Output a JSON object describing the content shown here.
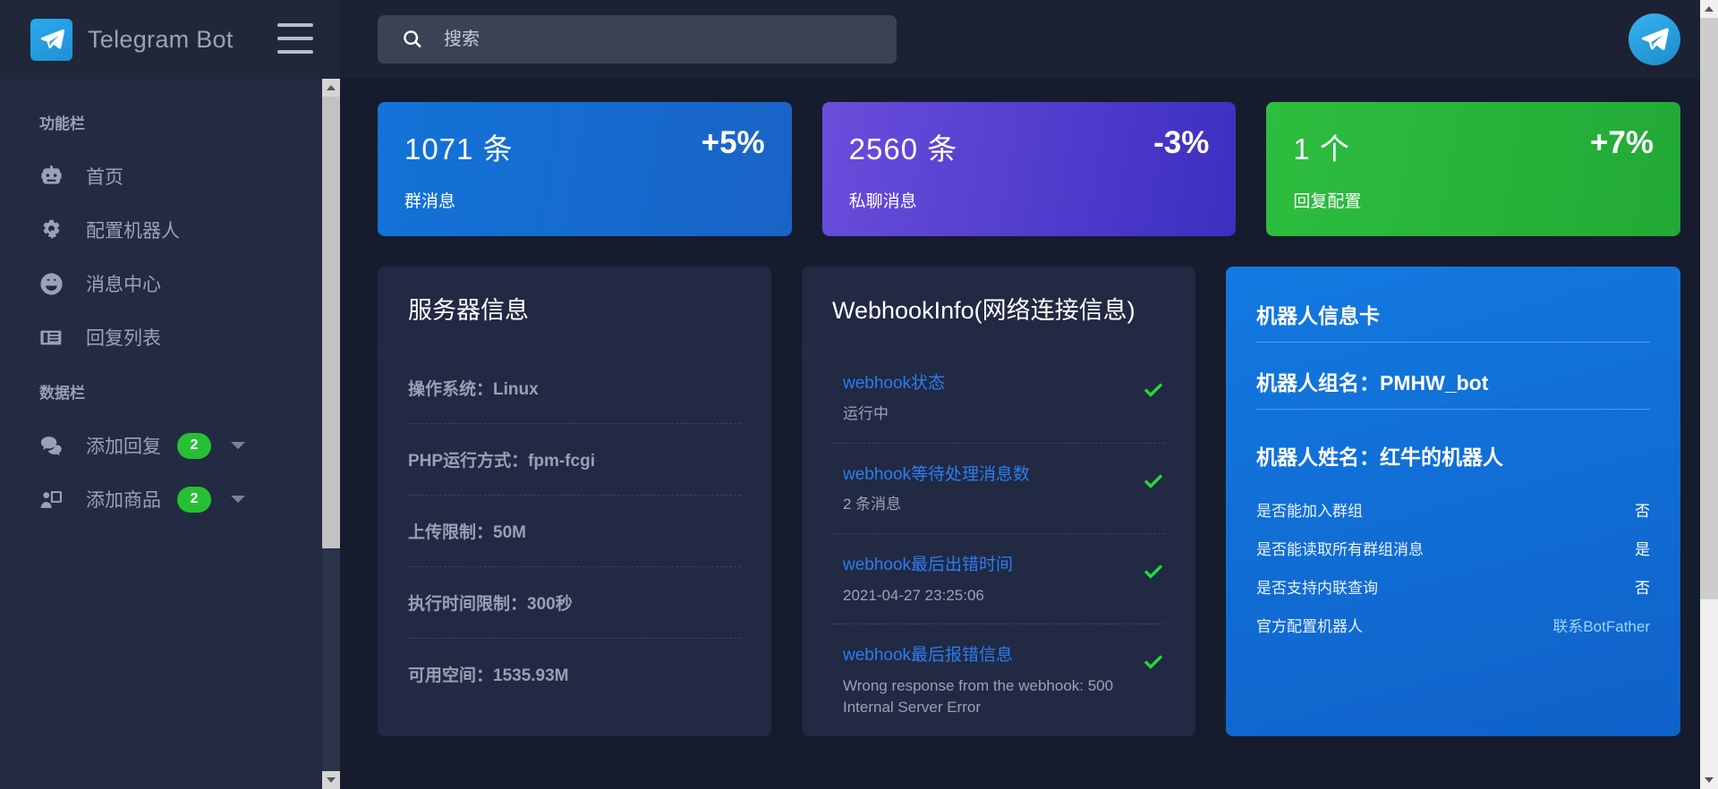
{
  "brand": {
    "title": "Telegram Bot",
    "logo_icon": "telegram-paper-plane-icon",
    "menu_icon": "hamburger-menu-icon"
  },
  "sidebar": {
    "section_1_title": "功能栏",
    "section_2_title": "数据栏",
    "items": [
      {
        "label": "首页",
        "icon": "robot-icon",
        "badge": null,
        "caret": false
      },
      {
        "label": "配置机器人",
        "icon": "gears-icon",
        "badge": null,
        "caret": false
      },
      {
        "label": "消息中心",
        "icon": "smiley-face-icon",
        "badge": null,
        "caret": false
      },
      {
        "label": "回复列表",
        "icon": "newspaper-icon",
        "badge": null,
        "caret": false
      }
    ],
    "data_items": [
      {
        "label": "添加回复",
        "icon": "chat-bubbles-icon",
        "badge": "2",
        "caret": true
      },
      {
        "label": "添加商品",
        "icon": "user-screen-icon",
        "badge": "2",
        "caret": true
      }
    ]
  },
  "topbar": {
    "search_placeholder": "搜索",
    "search_value": "",
    "search_icon": "search-icon",
    "avatar_icon": "telegram-paper-plane-icon"
  },
  "stats": [
    {
      "value": "1071 条",
      "pct": "+5%",
      "label": "群消息",
      "color": "#1273d8",
      "theme": "blue"
    },
    {
      "value": "2560 条",
      "pct": "-3%",
      "label": "私聊消息",
      "color": "#6a4ddb",
      "theme": "purple"
    },
    {
      "value": "1 个",
      "pct": "+7%",
      "label": "回复配置",
      "color": "#2dbe3f",
      "theme": "green"
    }
  ],
  "server_panel": {
    "title": "服务器信息",
    "rows": [
      "操作系统：Linux",
      "PHP运行方式：fpm-fcgi",
      "上传限制：50M",
      "执行时间限制：300秒",
      "可用空间：1535.93M"
    ]
  },
  "webhook_panel": {
    "title": "WebhookInfo(网络连接信息)",
    "check_icon": "green-check-icon",
    "rows": [
      {
        "key": "webhook状态",
        "value": "运行中",
        "ok": true
      },
      {
        "key": "webhook等待处理消息数",
        "value": "2 条消息",
        "ok": true
      },
      {
        "key": "webhook最后出错时间",
        "value": "2021-04-27 23:25:06",
        "ok": true
      },
      {
        "key": "webhook最后报错信息",
        "value": "Wrong response from the webhook: 500 Internal Server Error",
        "ok": true
      }
    ]
  },
  "bot_card": {
    "title": "机器人信息卡",
    "group_label": "机器人组名：PMHW_bot",
    "name_label": "机器人姓名：红牛的机器人",
    "attrs": [
      {
        "key": "是否能加入群组",
        "value": "否",
        "is_link": false
      },
      {
        "key": "是否能读取所有群组消息",
        "value": "是",
        "is_link": false
      },
      {
        "key": "是否支持内联查询",
        "value": "否",
        "is_link": false
      },
      {
        "key": "官方配置机器人",
        "value": "联系BotFather",
        "is_link": true
      }
    ]
  },
  "colors": {
    "page_bg": "#161c2d",
    "sidebar_bg": "#232b42",
    "panel_bg": "#212943",
    "accent_blue": "#2b7df0",
    "accent_green": "#27c034",
    "text_muted": "#9aa3b6"
  }
}
